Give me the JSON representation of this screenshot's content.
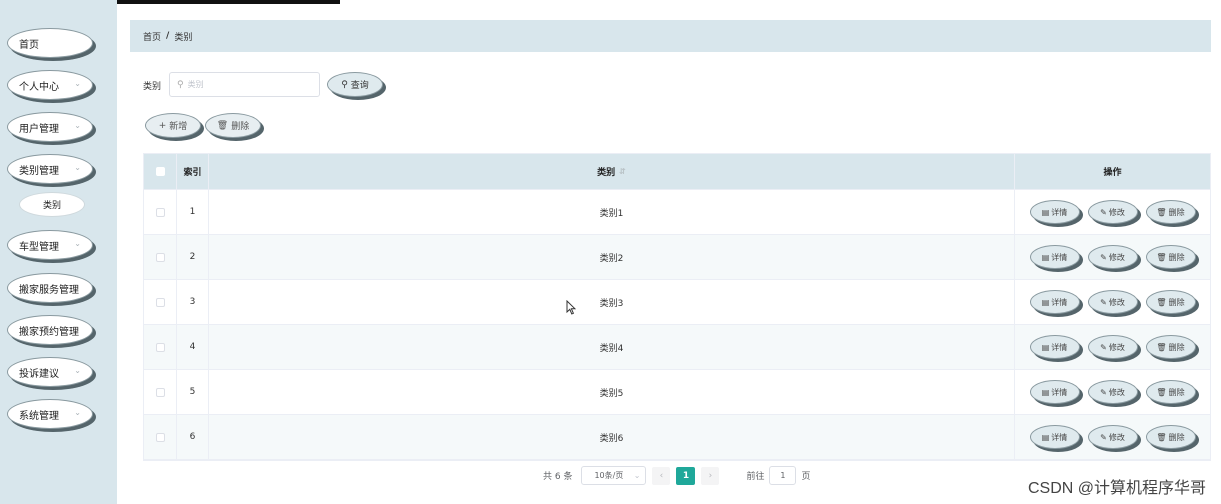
{
  "sidebar": {
    "items": [
      {
        "label": "首页",
        "has_chevron": false
      },
      {
        "label": "个人中心",
        "has_chevron": true
      },
      {
        "label": "用户管理",
        "has_chevron": true
      },
      {
        "label": "类别管理",
        "has_chevron": true
      },
      {
        "label": "车型管理",
        "has_chevron": true
      },
      {
        "label": "搬家服务管理",
        "has_chevron": false
      },
      {
        "label": "搬家预约管理",
        "has_chevron": false
      },
      {
        "label": "投诉建议",
        "has_chevron": true
      },
      {
        "label": "系统管理",
        "has_chevron": true
      }
    ],
    "sub_item": "类别"
  },
  "breadcrumb": {
    "home": "首页",
    "separator": "/",
    "current": "类别"
  },
  "search": {
    "label": "类别",
    "placeholder": "类别",
    "value": "",
    "query_button": "查询"
  },
  "toolbar": {
    "add_label": "新增",
    "delete_label": "删除"
  },
  "table": {
    "columns": {
      "index": "索引",
      "category": "类别",
      "actions": "操作"
    },
    "rows": [
      {
        "index": "1",
        "category": "类别1"
      },
      {
        "index": "2",
        "category": "类别2"
      },
      {
        "index": "3",
        "category": "类别3"
      },
      {
        "index": "4",
        "category": "类别4"
      },
      {
        "index": "5",
        "category": "类别5"
      },
      {
        "index": "6",
        "category": "类别6"
      }
    ],
    "actions": {
      "detail": "详情",
      "edit": "修改",
      "delete": "删除"
    }
  },
  "pagination": {
    "total_text": "共 6 条",
    "page_size": "10条/页",
    "current_page": "1",
    "goto_label": "前往",
    "goto_value": "1",
    "page_suffix": "页"
  },
  "watermark": "CSDN @计算机程序华哥",
  "colors": {
    "accent": "#1fa89a",
    "panel": "#d8e6ec"
  }
}
